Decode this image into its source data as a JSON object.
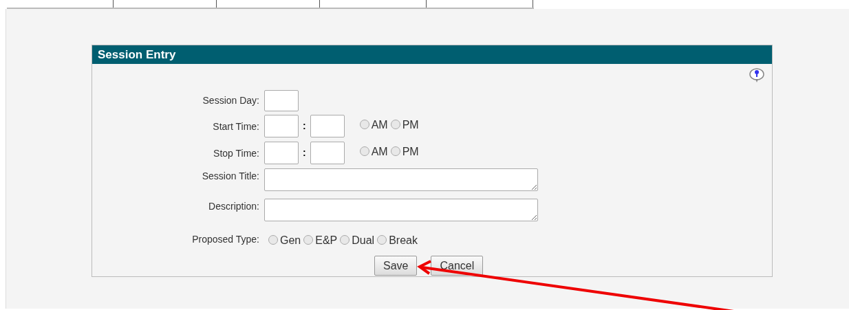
{
  "panel": {
    "title": "Session Entry"
  },
  "fields": [
    {
      "kind": "text",
      "label": "Session Day:"
    },
    {
      "kind": "time",
      "label": "Start Time:",
      "separator": ":",
      "options": [
        {
          "label": "AM",
          "selected": false
        },
        {
          "label": "PM",
          "selected": false
        }
      ]
    },
    {
      "kind": "time",
      "label": "Stop Time:",
      "separator": ":",
      "options": [
        {
          "label": "AM",
          "selected": false
        },
        {
          "label": "PM",
          "selected": false
        }
      ]
    },
    {
      "kind": "textarea",
      "label": "Session Title:"
    },
    {
      "kind": "textarea",
      "label": "Description:"
    },
    {
      "kind": "radio",
      "label": "Proposed Type:",
      "options": [
        {
          "label": "Gen",
          "selected": false
        },
        {
          "label": "E&P",
          "selected": false
        },
        {
          "label": "Dual",
          "selected": false
        },
        {
          "label": "Break",
          "selected": false
        }
      ]
    }
  ],
  "buttons": [
    "Save",
    "Cancel"
  ]
}
